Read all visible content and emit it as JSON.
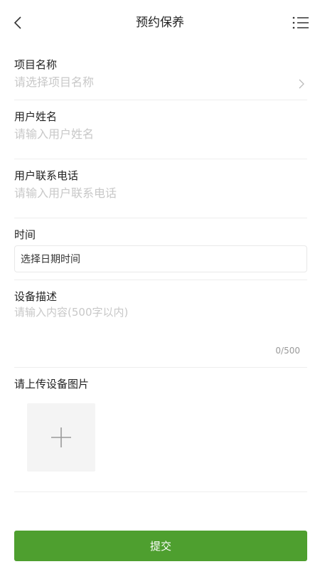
{
  "header": {
    "title": "预约保养",
    "back_icon": "chevron-left-icon",
    "menu_icon": "list-menu-icon"
  },
  "form": {
    "project_name": {
      "label": "项目名称",
      "placeholder": "请选择项目名称"
    },
    "user_name": {
      "label": "用户姓名",
      "placeholder": "请输入用户姓名"
    },
    "user_phone": {
      "label": "用户联系电话",
      "placeholder": "请输入用户联系电话"
    },
    "time": {
      "label": "时间",
      "value": "选择日期时间"
    },
    "description": {
      "label": "设备描述",
      "placeholder": "请输入内容(500字以内)",
      "counter": "0/500"
    },
    "upload": {
      "label": "请上传设备图片",
      "icon": "plus-icon"
    }
  },
  "footer": {
    "submit_label": "提交"
  },
  "colors": {
    "primary": "#4e9f2f",
    "placeholder": "#c8c8c8",
    "divider": "#eeeeee",
    "upload_bg": "#f4f4f4"
  }
}
